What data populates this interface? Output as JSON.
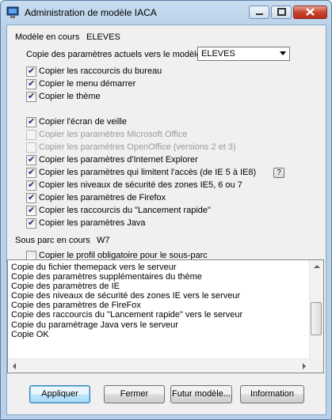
{
  "window": {
    "title": "Administration de modèle IACA"
  },
  "model": {
    "label": "Modèle en cours",
    "value": "ELEVES"
  },
  "copy_params": {
    "label": "Copie des paramètres actuels vers le modèle",
    "selected": "ELEVES"
  },
  "options": [
    {
      "label": "Copier les raccourcis du bureau",
      "checked": true,
      "enabled": true
    },
    {
      "label": "Copier le menu démarrer",
      "checked": true,
      "enabled": true
    },
    {
      "label": "Copier le thème",
      "checked": true,
      "enabled": true
    },
    {
      "label": "Copier l'écran de veille",
      "checked": true,
      "enabled": true
    },
    {
      "label": "Copier les paramètres Microsoft Office",
      "checked": false,
      "enabled": false
    },
    {
      "label": "Copier les paramètres OpenOffice (versions 2 et 3)",
      "checked": false,
      "enabled": false
    },
    {
      "label": "Copier les paramètres d'Internet Explorer",
      "checked": true,
      "enabled": true
    },
    {
      "label": "Copier les paramètres qui limitent l'accès (de IE 5 à IE8)",
      "checked": true,
      "enabled": true
    },
    {
      "label": "Copier les niveaux de sécurité des zones IE5, 6 ou 7",
      "checked": true,
      "enabled": true
    },
    {
      "label": "Copier les paramètres de Firefox",
      "checked": true,
      "enabled": true
    },
    {
      "label": "Copier les raccourcis du \"Lancement rapide\"",
      "checked": true,
      "enabled": true
    },
    {
      "label": "Copier les paramètres Java",
      "checked": true,
      "enabled": true
    }
  ],
  "help_label": "?",
  "subpark": {
    "label": "Sous parc en cours",
    "value": "W7"
  },
  "profile": {
    "label": "Copier le profil obligatoire pour le sous-parc",
    "checked": false
  },
  "log": [
    "Copie du fichier themepack vers le serveur",
    "Copie des paramètres supplémentaires du thème",
    "Copie des paramètres de IE",
    "Copie des niveaux de sécurité des zones IE vers le serveur",
    "Copie des paramètres de FireFox",
    "Copie des raccourcis du \"Lancement rapide\" vers le serveur",
    "Copie du paramétrage Java vers le serveur",
    "Copie OK"
  ],
  "buttons": {
    "apply": "Appliquer",
    "close": "Fermer",
    "future": "Futur modèle...",
    "info": "Information"
  }
}
